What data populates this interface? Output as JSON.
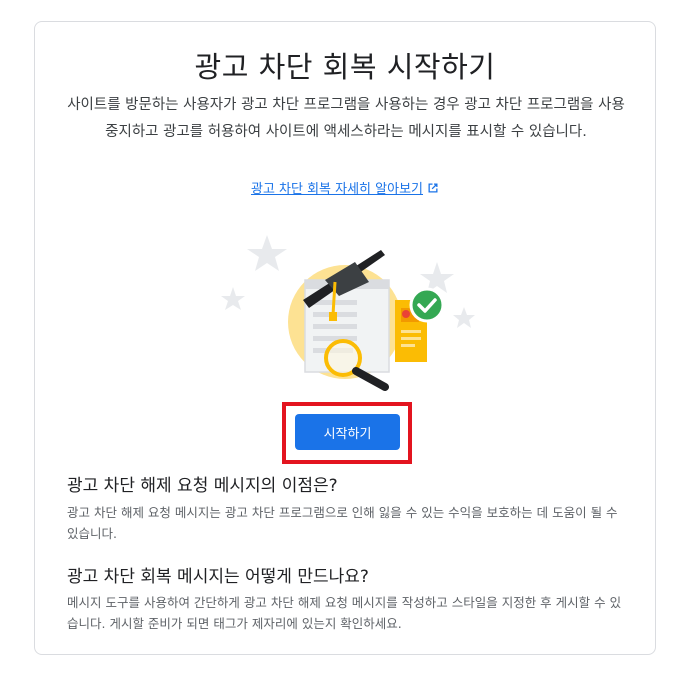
{
  "header": {
    "title": "광고 차단 회복 시작하기",
    "description": "사이트를 방문하는 사용자가 광고 차단 프로그램을 사용하는 경우 광고 차단 프로그램을 사용 중지하고 광고를 허용하여 사이트에 액세스하라는 메시지를 표시할 수 있습니다."
  },
  "learn_more": {
    "label": "광고 차단 회복 자세히 알아보기",
    "icon": "external-link-icon"
  },
  "illustration": {
    "icons": [
      "star-icon",
      "graduation-cap-icon",
      "webpage-icon",
      "magnifier-icon",
      "checkmark-icon"
    ],
    "colors": {
      "background_circle": "#fde293",
      "cap": "#202124",
      "check_badge": "#34a853",
      "ad_card": "#fbbc04",
      "star": "#e8eaed"
    }
  },
  "primary_action": {
    "label": "시작하기",
    "color": "#1a73e8",
    "highlight_color": "#e3141f"
  },
  "sections": [
    {
      "title": "광고 차단 해제 요청 메시지의 이점은?",
      "body": "광고 차단 해제 요청 메시지는 광고 차단 프로그램으로 인해 잃을 수 있는 수익을 보호하는 데 도움이 될 수 있습니다."
    },
    {
      "title": "광고 차단 회복 메시지는 어떻게 만드나요?",
      "body": "메시지 도구를 사용하여 간단하게 광고 차단 해제 요청 메시지를 작성하고 스타일을 지정한 후 게시할 수 있습니다. 게시할 준비가 되면 태그가 제자리에 있는지 확인하세요."
    }
  ]
}
